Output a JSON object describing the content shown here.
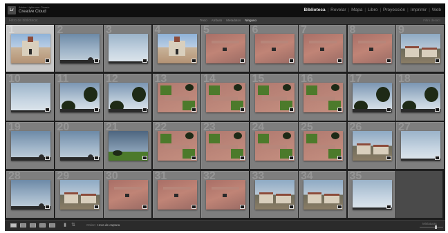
{
  "identity": {
    "logo": "Lr",
    "subtitle": "Adobe Lightroom Classic",
    "title": "Creative Cloud"
  },
  "modules": [
    "Biblioteca",
    "Revelar",
    "Mapa",
    "Libro",
    "Proyección",
    "Imprimir",
    "Web"
  ],
  "active_module": "Biblioteca",
  "filter": {
    "title": "Filtro de biblioteca:",
    "tabs": [
      "Texto",
      "Atributo",
      "Metadatos",
      "Ninguno"
    ],
    "active_tab": "Ninguno",
    "right": "Filtro desact."
  },
  "grid": {
    "cells": [
      {
        "n": "1",
        "t": "church"
      },
      {
        "n": "2",
        "t": "sky"
      },
      {
        "n": "3",
        "t": "sky-light"
      },
      {
        "n": "4",
        "t": "church"
      },
      {
        "n": "5",
        "t": "plaza"
      },
      {
        "n": "6",
        "t": "plaza"
      },
      {
        "n": "7",
        "t": "plaza"
      },
      {
        "n": "8",
        "t": "plaza"
      },
      {
        "n": "9",
        "t": "town"
      },
      {
        "n": "10",
        "t": "sky-light"
      },
      {
        "n": "11",
        "t": "treesky"
      },
      {
        "n": "12",
        "t": "treesky"
      },
      {
        "n": "13",
        "t": "plaza-g"
      },
      {
        "n": "14",
        "t": "plaza-g"
      },
      {
        "n": "15",
        "t": "plaza-g"
      },
      {
        "n": "16",
        "t": "plaza-g"
      },
      {
        "n": "17",
        "t": "treesky"
      },
      {
        "n": "18",
        "t": "treesky"
      },
      {
        "n": "19",
        "t": "sky"
      },
      {
        "n": "20",
        "t": "sky"
      },
      {
        "n": "21",
        "t": "sky-dark"
      },
      {
        "n": "22",
        "t": "plaza-g"
      },
      {
        "n": "23",
        "t": "plaza-g"
      },
      {
        "n": "24",
        "t": "plaza-g"
      },
      {
        "n": "25",
        "t": "plaza-g"
      },
      {
        "n": "26",
        "t": "town"
      },
      {
        "n": "27",
        "t": "sky-light"
      },
      {
        "n": "28",
        "t": "sky"
      },
      {
        "n": "29",
        "t": "town"
      },
      {
        "n": "30",
        "t": "plaza"
      },
      {
        "n": "31",
        "t": "plaza"
      },
      {
        "n": "32",
        "t": "plaza"
      },
      {
        "n": "33",
        "t": "town"
      },
      {
        "n": "34",
        "t": "town"
      },
      {
        "n": "35",
        "t": "sky-light"
      }
    ],
    "selected": "1"
  },
  "toolbar": {
    "sort_label": "Orden:",
    "sort_value": "Hora de captura",
    "thumb_label": "Miniaturas"
  }
}
